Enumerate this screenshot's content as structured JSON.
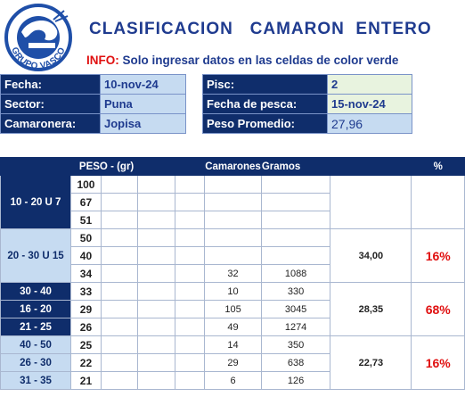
{
  "logo": {
    "text": "GRUPO VASCO",
    "icon": "shrimp-logo-icon",
    "color": "#1f4fa8"
  },
  "title": "CLASIFICACION   CAMARON  ENTERO",
  "info": {
    "label": "INFO:",
    "text": " Solo ingresar datos en las celdas de color verde"
  },
  "fields_left": [
    {
      "label": "Fecha:",
      "value": "10-nov-24"
    },
    {
      "label": "Sector:",
      "value": "Puna"
    },
    {
      "label": "Camaronera:",
      "value": "Jopisa"
    }
  ],
  "fields_right": [
    {
      "label": "Pisc:",
      "value": "2"
    },
    {
      "label": "Fecha de pesca:",
      "value": "15-nov-24"
    },
    {
      "label": "Peso Promedio:",
      "value": "27,96"
    }
  ],
  "table": {
    "headers": {
      "peso": "PESO - (gr)",
      "camarones": "Camarones",
      "gramos": "Gramos",
      "pct": "%"
    },
    "groups": [
      {
        "style": "dark",
        "range_single": "10 - 20  U 7",
        "rows": [
          {
            "peso": "100",
            "camarones": "",
            "gramos": ""
          },
          {
            "peso": "67",
            "camarones": "",
            "gramos": ""
          },
          {
            "peso": "51",
            "camarones": "",
            "gramos": ""
          }
        ],
        "avg": "",
        "pct": ""
      },
      {
        "style": "light",
        "range_single": "20 - 30  U 15",
        "rows": [
          {
            "peso": "50",
            "camarones": "",
            "gramos": ""
          },
          {
            "peso": "40",
            "camarones": "",
            "gramos": ""
          },
          {
            "peso": "34",
            "camarones": "32",
            "gramos": "1088"
          }
        ],
        "avg": "34,00",
        "pct": "16%"
      },
      {
        "style": "dark",
        "rows": [
          {
            "range": "30 - 40",
            "peso": "33",
            "camarones": "10",
            "gramos": "330"
          },
          {
            "range": "16 - 20",
            "peso": "29",
            "camarones": "105",
            "gramos": "3045"
          },
          {
            "range": "21 - 25",
            "peso": "26",
            "camarones": "49",
            "gramos": "1274"
          }
        ],
        "avg": "28,35",
        "pct": "68%"
      },
      {
        "style": "light",
        "rows": [
          {
            "range": "40 - 50",
            "peso": "25",
            "camarones": "14",
            "gramos": "350"
          },
          {
            "range": "26 - 30",
            "peso": "22",
            "camarones": "29",
            "gramos": "638"
          },
          {
            "range": "31 - 35",
            "peso": "21",
            "camarones": "6",
            "gramos": "126"
          }
        ],
        "avg": "22,73",
        "pct": "16%"
      }
    ]
  }
}
